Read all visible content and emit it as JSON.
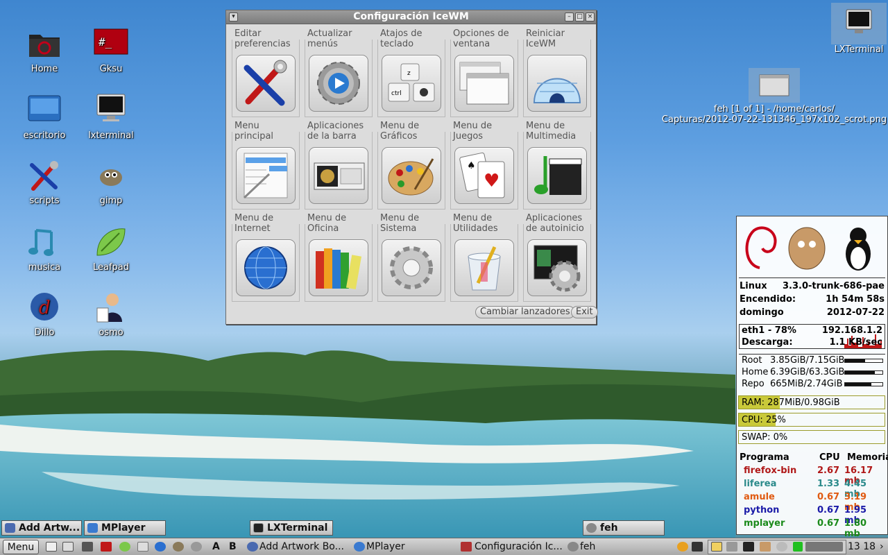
{
  "desktop": {
    "icons": [
      {
        "label": "Home",
        "icon": "folder-red-icon"
      },
      {
        "label": "Gksu",
        "icon": "terminal-red-icon"
      },
      {
        "label": "escritorio",
        "icon": "desktop-folder-icon"
      },
      {
        "label": "lxterminal",
        "icon": "monitor-icon"
      },
      {
        "label": "scripts",
        "icon": "tools-icon"
      },
      {
        "label": "gimp",
        "icon": "gimp-icon"
      },
      {
        "label": "musica",
        "icon": "music-note-icon"
      },
      {
        "label": "Leafpad",
        "icon": "leafpad-icon"
      },
      {
        "label": "Dillo",
        "icon": "dillo-icon"
      },
      {
        "label": "osmo",
        "icon": "osmo-icon"
      }
    ],
    "lxterminal_label": "LXTerminal",
    "feh_label_line1": "feh [1 of 1] - /home/carlos/",
    "feh_label_line2": "Capturas/2012-07-22-131346_197x102_scrot.png"
  },
  "window": {
    "title": "Configuración IceWM",
    "items": [
      {
        "label1": "Editar",
        "label2": "preferencias",
        "icon": "wrench-screwdriver-icon"
      },
      {
        "label1": "Actualizar",
        "label2": "menús",
        "icon": "gear-play-icon"
      },
      {
        "label1": "Atajos de",
        "label2": "teclado",
        "icon": "keyboard-keys-icon"
      },
      {
        "label1": "Opciones de",
        "label2": "ventana",
        "icon": "windows-icon"
      },
      {
        "label1": "Reiniciar",
        "label2": "IceWM",
        "icon": "igloo-icon"
      },
      {
        "label1": "Menu",
        "label2": "principal",
        "icon": "menu-list-icon"
      },
      {
        "label1": "Aplicaciones",
        "label2": "de la barra",
        "icon": "taskbar-app-icon"
      },
      {
        "label1": "Menu de",
        "label2": "Gráficos",
        "icon": "palette-icon"
      },
      {
        "label1": "Menu de",
        "label2": "Juegos",
        "icon": "cards-icon"
      },
      {
        "label1": "Menu de",
        "label2": "Multimedia",
        "icon": "clapper-icon"
      },
      {
        "label1": "Menu de",
        "label2": "Internet",
        "icon": "globe-icon"
      },
      {
        "label1": "Menu de",
        "label2": "Oficina",
        "icon": "books-icon"
      },
      {
        "label1": "Menu de",
        "label2": "Sistema",
        "icon": "system-gear-icon"
      },
      {
        "label1": "Menu de",
        "label2": "Utilidades",
        "icon": "trash-pen-icon"
      },
      {
        "label1": "Aplicaciones",
        "label2": "de autoinicio",
        "icon": "autostart-icon"
      }
    ],
    "change_launchers": "Cambiar lanzadores",
    "exit": "Exit"
  },
  "conky": {
    "os": "Linux",
    "kernel": "3.3.0-trunk-686-pae",
    "uptime_label": "Encendido:",
    "uptime": "1h 54m 58s",
    "day": "domingo",
    "date": "2012-07-22",
    "net_label": "eth1 - 78%",
    "ip": "192.168.1.2",
    "download_label": "Descarga:",
    "download": "1.1 KB/sec",
    "disks": [
      {
        "name": "Root",
        "usage": "3.85GiB/7.15GiB",
        "fraction": 0.54
      },
      {
        "name": "Home",
        "usage": "6.39GiB/63.3GiB",
        "fraction": 0.8
      },
      {
        "name": "Repo",
        "usage": "665MiB/2.74GiB",
        "fraction": 0.7
      }
    ],
    "ram": "RAM: 287MiB/0.98GiB",
    "ram_fraction": 0.28,
    "cpu": "CPU: 25%",
    "cpu_fraction": 0.25,
    "swap": "SWAP: 0%",
    "proc_headers": [
      "Programa",
      "CPU",
      "Memoria"
    ],
    "processes": [
      {
        "name": "firefox-bin",
        "cpu": "2.67",
        "mem": "16.17 mb",
        "color": "#b01818"
      },
      {
        "name": "liferea",
        "cpu": "1.33",
        "mem": "4.45 mb",
        "color": "#2a8a8a"
      },
      {
        "name": "amule",
        "cpu": "0.67",
        "mem": "3.19 mb",
        "color": "#e05a10"
      },
      {
        "name": "python",
        "cpu": "0.67",
        "mem": "1.95 mb",
        "color": "#1a1aa8"
      },
      {
        "name": "mplayer",
        "cpu": "0.67",
        "mem": "1.80 mb",
        "color": "#1a8a1a"
      }
    ]
  },
  "minimized": [
    {
      "label": "Add  Artw...",
      "icon": "artwork-icon"
    },
    {
      "label": "MPlayer",
      "icon": "mplayer-icon"
    },
    {
      "label": "LXTerminal",
      "icon": "terminal-icon"
    },
    {
      "label": "feh",
      "icon": "feh-icon"
    }
  ],
  "taskbar": {
    "menu": "Menu",
    "letter_a": "A",
    "letter_b": "B",
    "tasks": [
      {
        "label": "Add  Artwork Bo...",
        "icon": "artwork-icon"
      },
      {
        "label": "MPlayer",
        "icon": "mplayer-icon"
      },
      {
        "label": "Configuración Ic...",
        "icon": "tools-icon"
      },
      {
        "label": "feh",
        "icon": "feh-icon"
      }
    ],
    "clock": "13 18"
  }
}
